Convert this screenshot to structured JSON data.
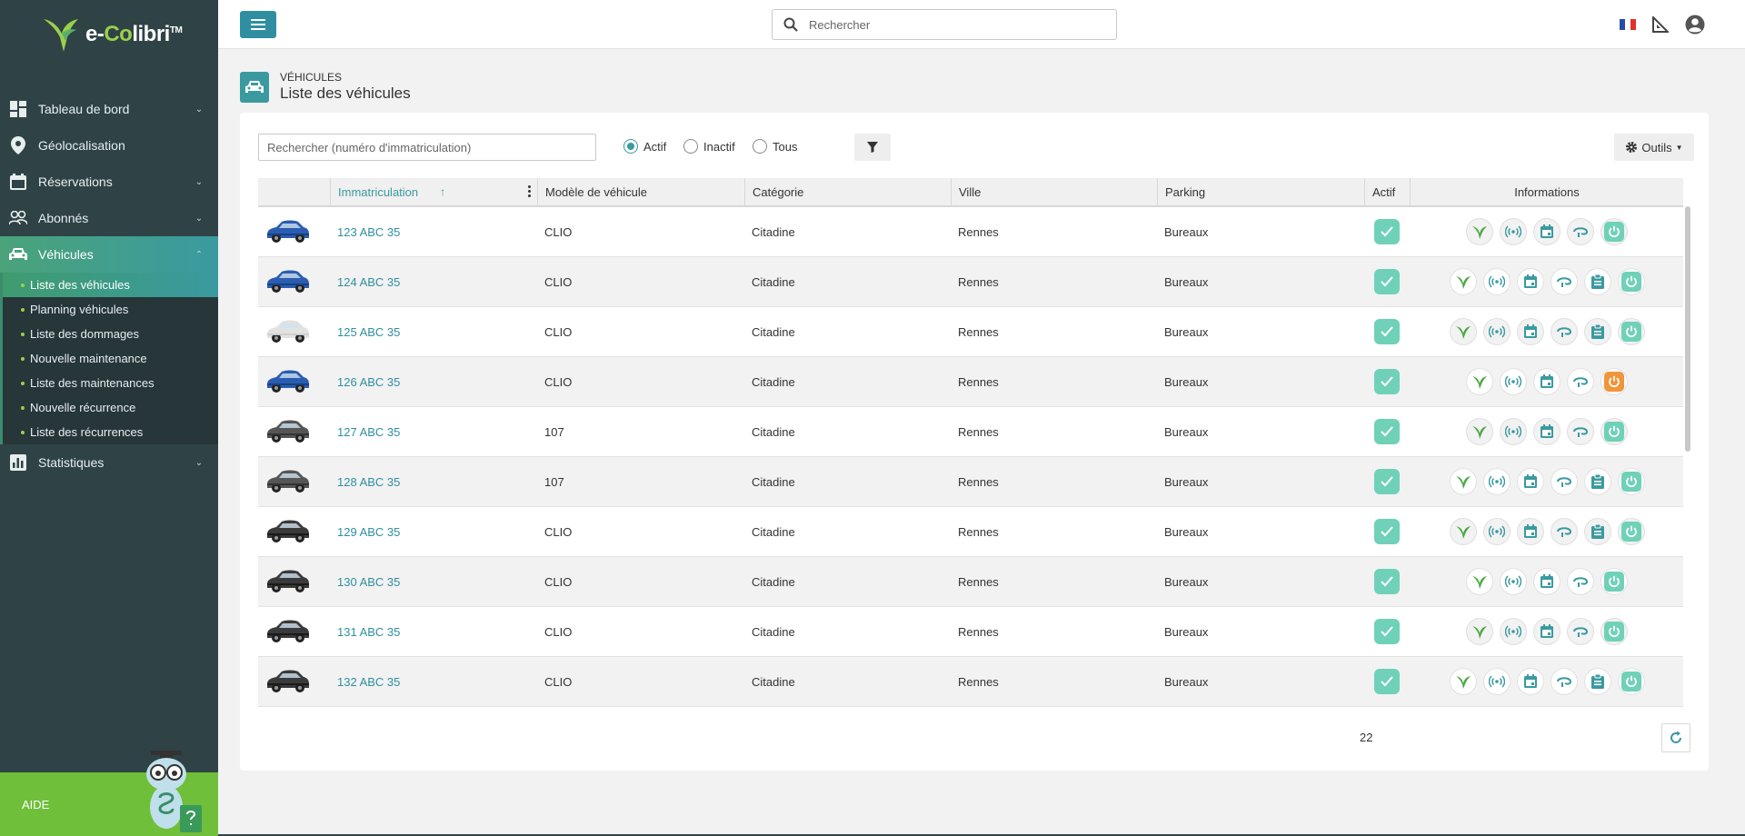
{
  "app": {
    "logo_prefix": "e-",
    "logo_co": "Co",
    "logo_suffix": "libri",
    "logo_tm": "TM"
  },
  "topbar": {
    "search_placeholder": "Rechercher",
    "language": "FR"
  },
  "sidebar": {
    "items": [
      {
        "label": "Tableau de bord",
        "icon": "dashboard-icon",
        "chevron": "down"
      },
      {
        "label": "Géolocalisation",
        "icon": "location-pin-icon",
        "chevron": ""
      },
      {
        "label": "Réservations",
        "icon": "calendar-icon",
        "chevron": "down"
      },
      {
        "label": "Abonnés",
        "icon": "users-icon",
        "chevron": "down"
      },
      {
        "label": "Véhicules",
        "icon": "car-icon",
        "chevron": "up",
        "active": true
      },
      {
        "label": "Statistiques",
        "icon": "chart-icon",
        "chevron": "down"
      }
    ],
    "vehicles_sub": [
      {
        "label": "Liste des véhicules",
        "active": true
      },
      {
        "label": "Planning véhicules"
      },
      {
        "label": "Liste des dommages"
      },
      {
        "label": "Nouvelle maintenance"
      },
      {
        "label": "Liste des maintenances"
      },
      {
        "label": "Nouvelle récurrence"
      },
      {
        "label": "Liste des récurrences"
      }
    ],
    "help_label": "AIDE"
  },
  "page": {
    "kicker": "VÉHICULES",
    "title": "Liste des véhicules"
  },
  "filters": {
    "plate_placeholder": "Rechercher (numéro d'immatriculation)",
    "radio_active": "Actif",
    "radio_inactive": "Inactif",
    "radio_all": "Tous",
    "selected": "Actif",
    "tools_label": "Outils"
  },
  "table": {
    "headers": {
      "plate": "Immatriculation",
      "model": "Modèle de véhicule",
      "category": "Catégorie",
      "city": "Ville",
      "parking": "Parking",
      "active": "Actif",
      "info": "Informations"
    },
    "rows": [
      {
        "plate": "123 ABC 35",
        "model": "CLIO",
        "category": "Citadine",
        "city": "Rennes",
        "parking": "Bureaux",
        "car": "blue",
        "report": false,
        "power": "teal"
      },
      {
        "plate": "124 ABC 35",
        "model": "CLIO",
        "category": "Citadine",
        "city": "Rennes",
        "parking": "Bureaux",
        "car": "blue",
        "report": true,
        "power": "teal"
      },
      {
        "plate": "125 ABC 35",
        "model": "CLIO",
        "category": "Citadine",
        "city": "Rennes",
        "parking": "Bureaux",
        "car": "ghost",
        "report": true,
        "power": "teal"
      },
      {
        "plate": "126 ABC 35",
        "model": "CLIO",
        "category": "Citadine",
        "city": "Rennes",
        "parking": "Bureaux",
        "car": "blue",
        "report": false,
        "power": "orange"
      },
      {
        "plate": "127 ABC 35",
        "model": "107",
        "category": "Citadine",
        "city": "Rennes",
        "parking": "Bureaux",
        "car": "dark",
        "report": false,
        "power": "teal"
      },
      {
        "plate": "128 ABC 35",
        "model": "107",
        "category": "Citadine",
        "city": "Rennes",
        "parking": "Bureaux",
        "car": "dark",
        "report": true,
        "power": "teal"
      },
      {
        "plate": "129 ABC 35",
        "model": "CLIO",
        "category": "Citadine",
        "city": "Rennes",
        "parking": "Bureaux",
        "car": "black",
        "report": true,
        "power": "teal"
      },
      {
        "plate": "130 ABC 35",
        "model": "CLIO",
        "category": "Citadine",
        "city": "Rennes",
        "parking": "Bureaux",
        "car": "black",
        "report": false,
        "power": "teal"
      },
      {
        "plate": "131 ABC 35",
        "model": "CLIO",
        "category": "Citadine",
        "city": "Rennes",
        "parking": "Bureaux",
        "car": "black",
        "report": false,
        "power": "teal"
      },
      {
        "plate": "132 ABC 35",
        "model": "CLIO",
        "category": "Citadine",
        "city": "Rennes",
        "parking": "Bureaux",
        "car": "black",
        "report": true,
        "power": "teal"
      }
    ],
    "total_count": "22"
  },
  "colors": {
    "accent": "#3a9aa0",
    "sidebar": "#2f4346",
    "check": "#6fd1b8",
    "brand_green": "#6fbf3a",
    "alert_orange": "#f0953a"
  }
}
